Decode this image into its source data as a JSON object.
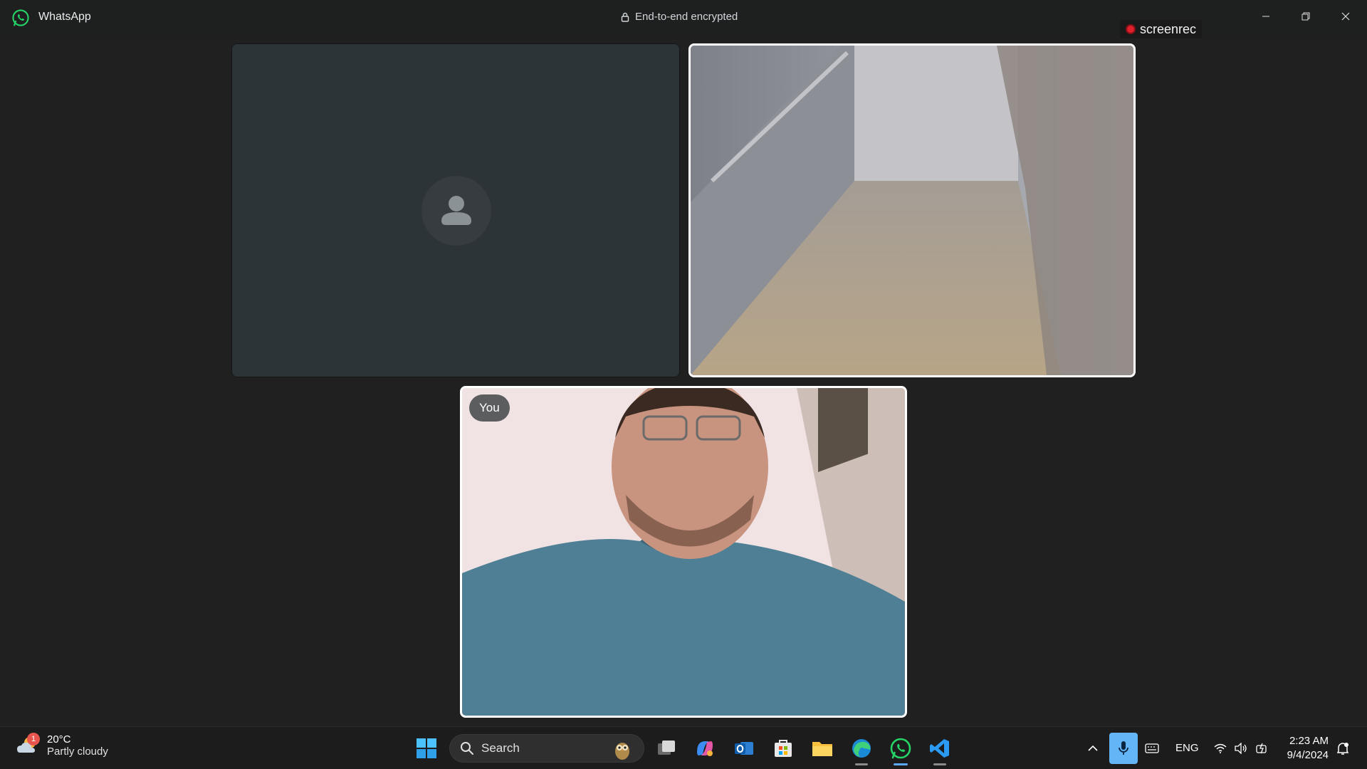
{
  "titlebar": {
    "app_name": "WhatsApp",
    "encryption_text": "End-to-end encrypted"
  },
  "overlay": {
    "screenrec_label": "screenrec"
  },
  "call": {
    "participants": [
      {
        "id": "participant-1",
        "video": "off"
      },
      {
        "id": "participant-2",
        "video": "on"
      },
      {
        "id": "self",
        "label": "You",
        "video": "on"
      }
    ]
  },
  "taskbar": {
    "weather": {
      "badge": "1",
      "temp": "20°C",
      "desc": "Partly cloudy"
    },
    "search_placeholder": "Search",
    "pinned_apps": [
      "start-icon",
      "task-view-icon",
      "copilot-icon",
      "outlook-icon",
      "microsoft-store-icon",
      "file-explorer-icon",
      "edge-icon",
      "whatsapp-icon",
      "vscode-icon"
    ],
    "tray": {
      "language": "ENG",
      "time": "2:23 AM",
      "date": "9/4/2024"
    }
  },
  "colors": {
    "accent": "#25d366",
    "taskbar_active": "#5aa8f2",
    "record": "#e0212b"
  }
}
